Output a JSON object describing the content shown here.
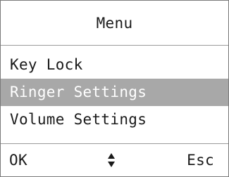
{
  "header": {
    "title": "Menu"
  },
  "menu": {
    "items": [
      {
        "label": "Key Lock",
        "selected": false
      },
      {
        "label": "Ringer Settings",
        "selected": true
      },
      {
        "label": "Volume Settings",
        "selected": false
      }
    ]
  },
  "softkeys": {
    "left_label": "OK",
    "center_icon": "up-down-arrows-icon",
    "right_label": "Esc"
  },
  "colors": {
    "background": "#ffffff",
    "text": "#1a1a1a",
    "selection_background": "#a8a8a8",
    "selection_text": "#ffffff",
    "border": "#7a7a7a"
  }
}
